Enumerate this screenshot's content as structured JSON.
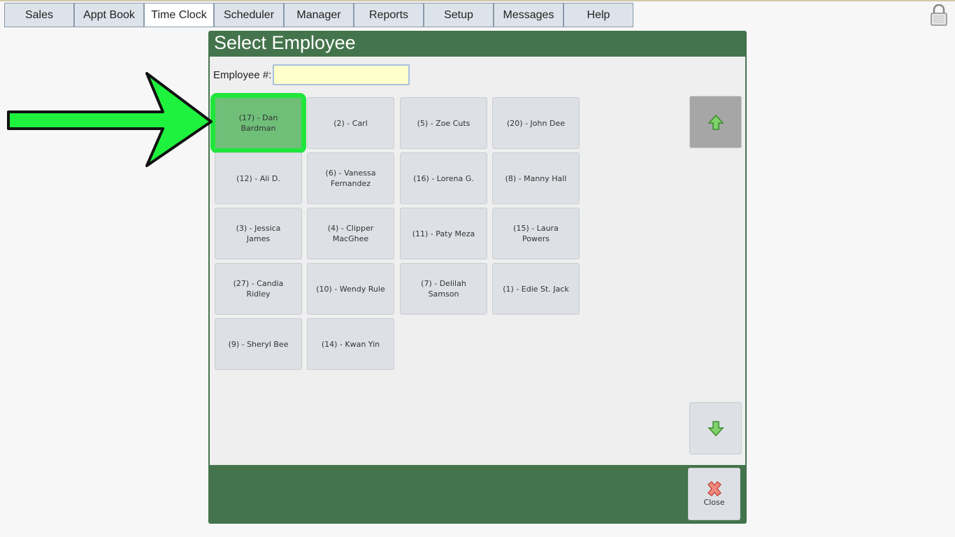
{
  "nav": {
    "tabs": [
      {
        "label": "Sales"
      },
      {
        "label": "Appt Book"
      },
      {
        "label": "Time Clock"
      },
      {
        "label": "Scheduler"
      },
      {
        "label": "Manager"
      },
      {
        "label": "Reports"
      },
      {
        "label": "Setup"
      },
      {
        "label": "Messages"
      },
      {
        "label": "Help"
      }
    ],
    "active_tab": "Time Clock",
    "lock_icon": "lock-icon"
  },
  "dialog": {
    "title": "Select Employee",
    "employee_label": "Employee #:",
    "employee_value": "",
    "employees": [
      {
        "label": "(17) - Dan Bardman",
        "highlighted": true
      },
      {
        "label": "(2) - Carl"
      },
      {
        "label": "(5) - Zoe Cuts"
      },
      {
        "label": "(20) - John Dee"
      },
      {
        "label": "(12) - Ali D."
      },
      {
        "label": "(6) - Vanessa Fernandez"
      },
      {
        "label": "(16) - Lorena G."
      },
      {
        "label": "(8) - Manny Hall"
      },
      {
        "label": "(3) - Jessica James"
      },
      {
        "label": "(4) - Clipper MacGhee"
      },
      {
        "label": "(11) - Paty Meza"
      },
      {
        "label": "(15) - Laura Powers"
      },
      {
        "label": "(27) - Candia Ridley"
      },
      {
        "label": "(10) - Wendy Rule"
      },
      {
        "label": "(7) - Delilah Samson"
      },
      {
        "label": "(1) - Edie St. Jack"
      },
      {
        "label": "(9) - Sheryl Bee"
      },
      {
        "label": "(14) - Kwan Yin"
      }
    ],
    "close_label": "Close"
  },
  "colors": {
    "dialog_green": "#44744c",
    "highlight_green": "#20e63c",
    "input_yellow": "#ffffcc"
  }
}
